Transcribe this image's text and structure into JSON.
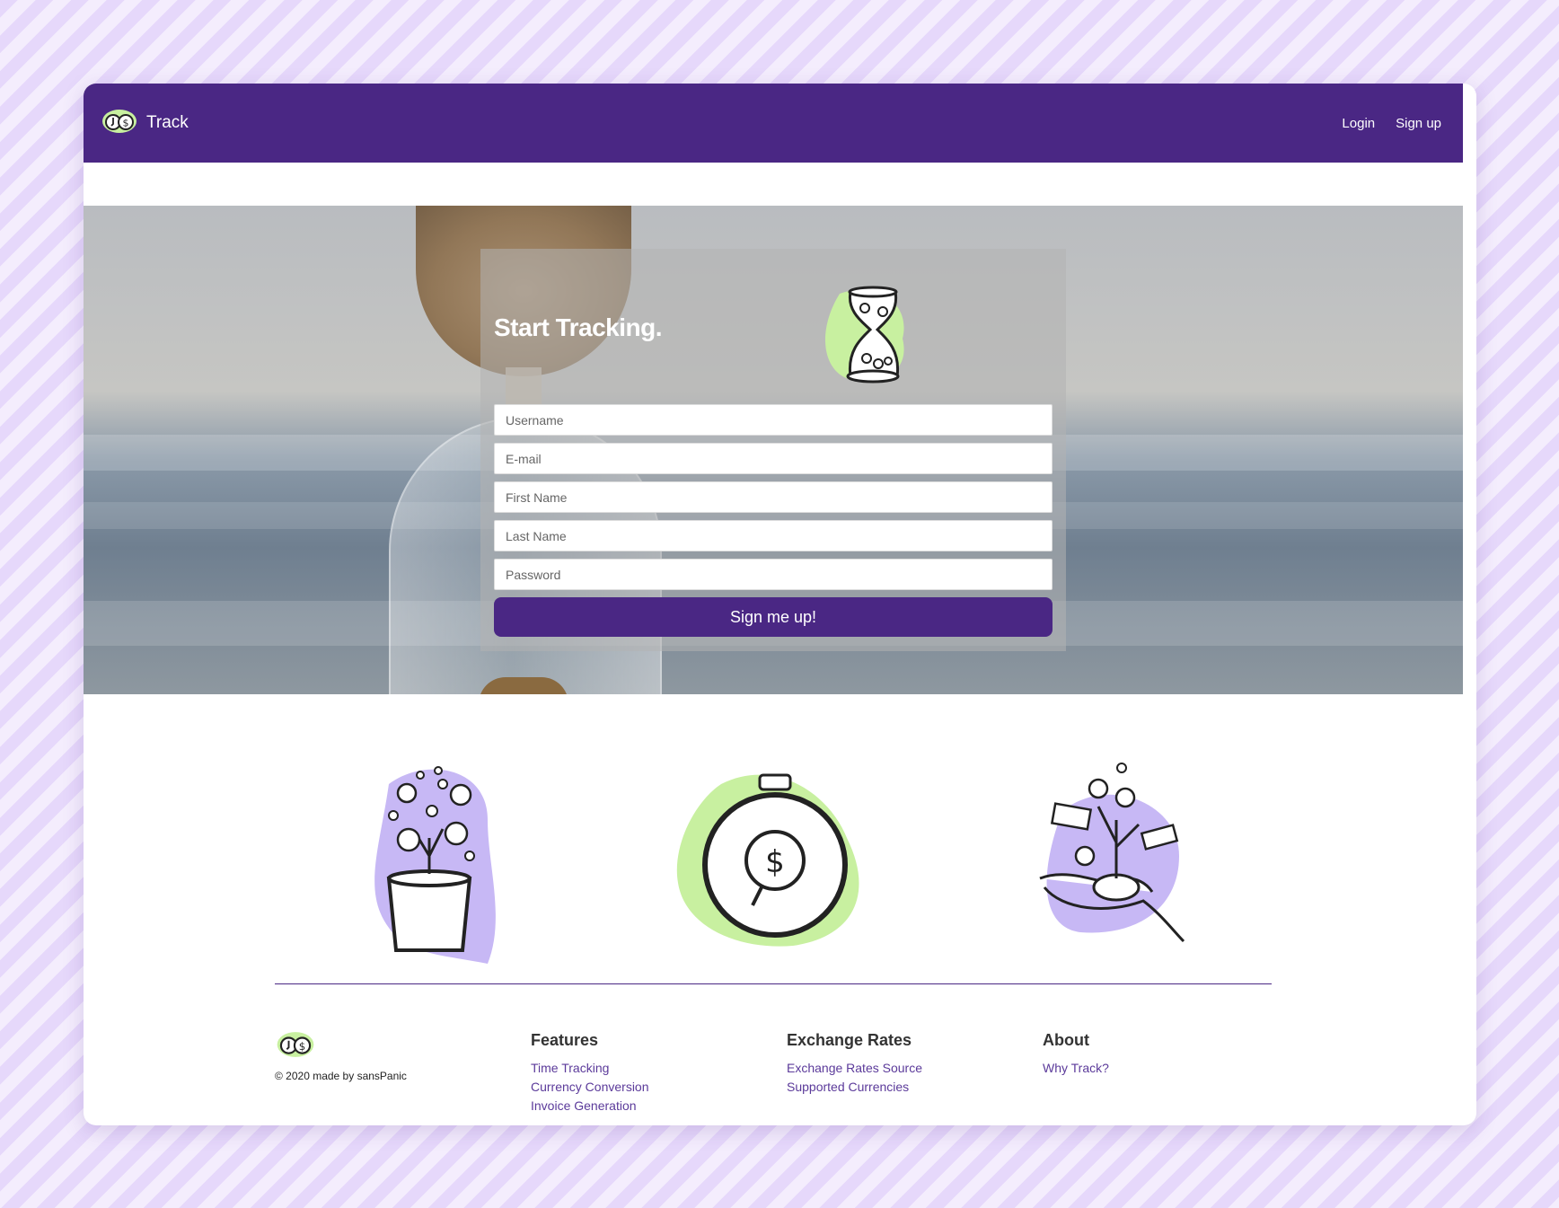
{
  "navbar": {
    "brand_title": "Track",
    "links": [
      "Login",
      "Sign up"
    ]
  },
  "signup": {
    "title": "Start Tracking.",
    "fields": {
      "username": "Username",
      "email": "E-mail",
      "first_name": "First Name",
      "last_name": "Last Name",
      "password": "Password"
    },
    "submit_label": "Sign me up!"
  },
  "footer": {
    "copyright": "© 2020 made by sansPanic",
    "columns": [
      {
        "heading": "Features",
        "links": [
          "Time Tracking",
          "Currency Conversion",
          "Invoice Generation"
        ]
      },
      {
        "heading": "Exchange Rates",
        "links": [
          "Exchange Rates Source",
          "Supported Currencies"
        ]
      },
      {
        "heading": "About",
        "links": [
          "Why Track?"
        ]
      }
    ]
  },
  "colors": {
    "brand_purple": "#4a2784",
    "accent_green": "#c8f0a0",
    "accent_lavender": "#c7b8f5",
    "link_purple": "#5b3a9a"
  },
  "icons": [
    "logo-icon",
    "hourglass-icon",
    "money-plant-icon",
    "stopwatch-dollar-icon",
    "hand-money-tree-icon"
  ]
}
